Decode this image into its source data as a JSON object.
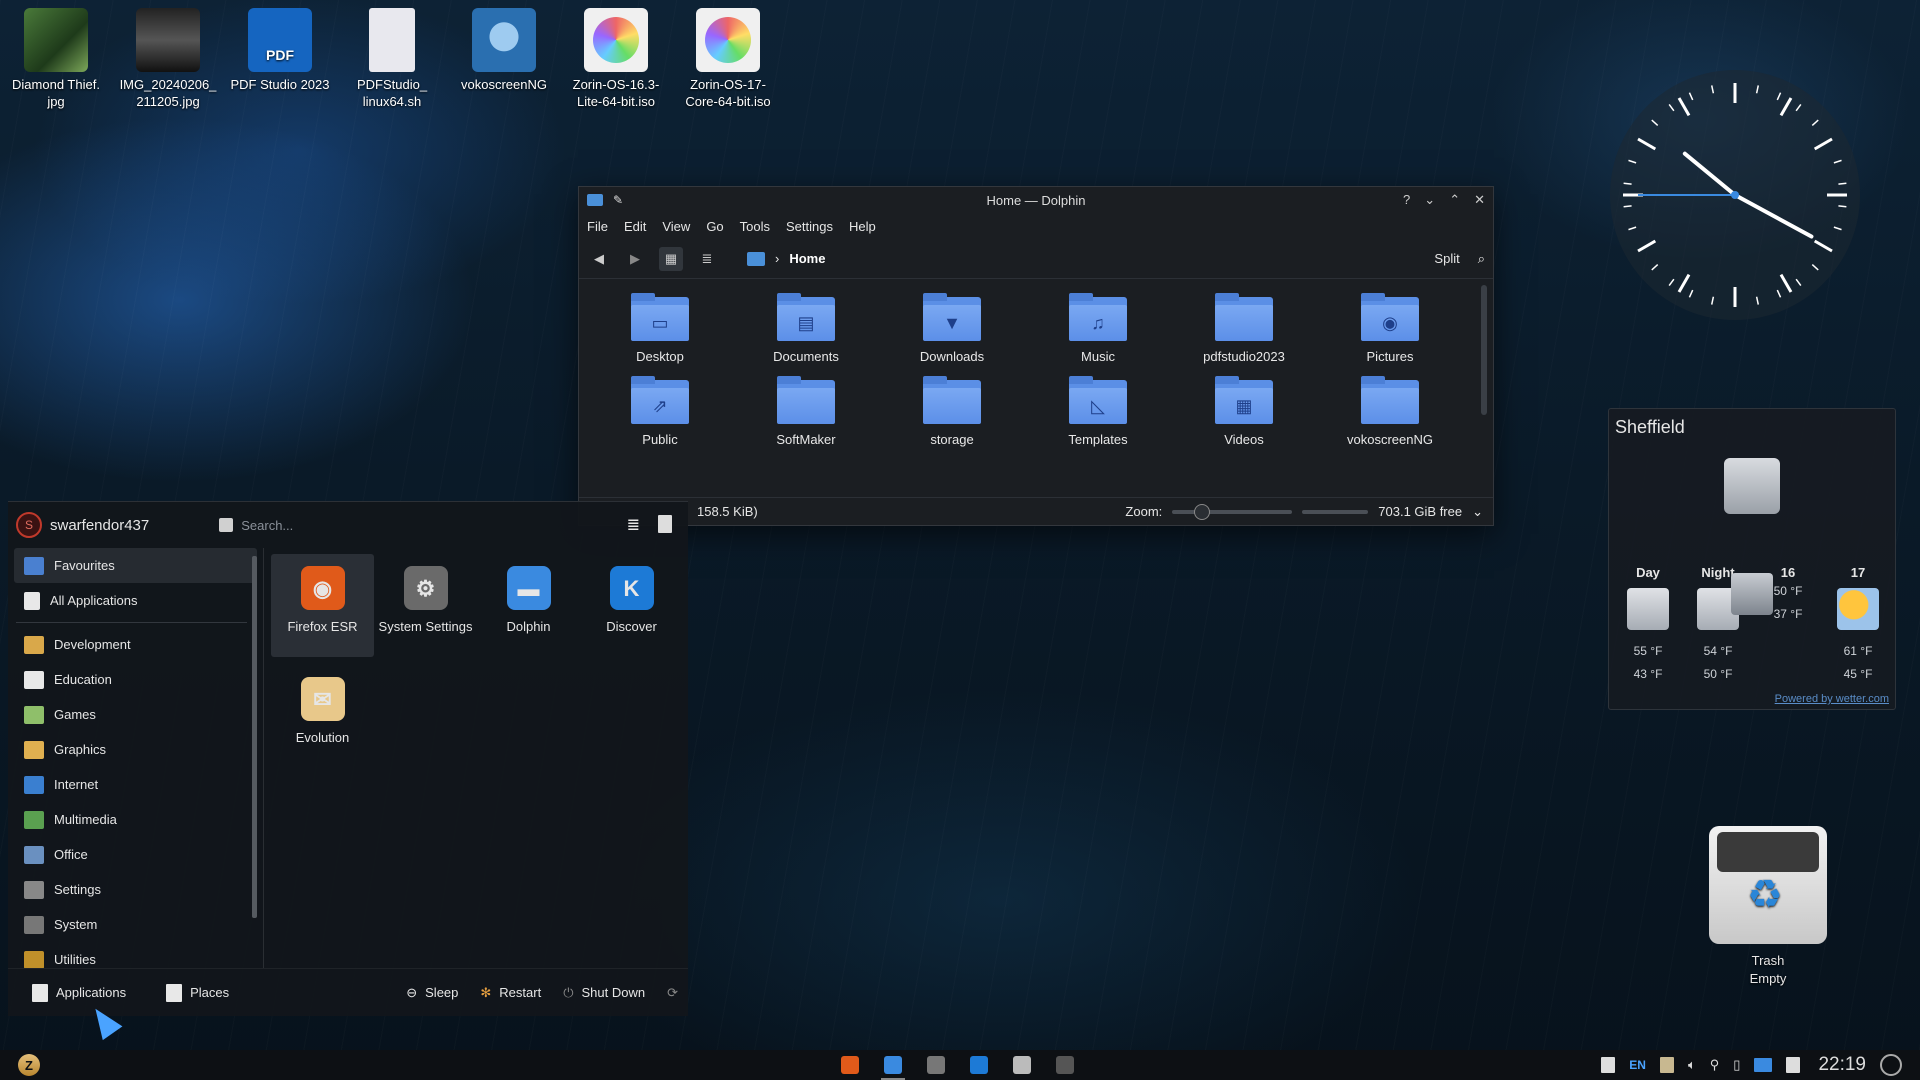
{
  "desktop": {
    "icons": [
      {
        "label": "Diamond Thief.\njpg",
        "line1": "Diamond Thief.",
        "line2": "jpg",
        "icon": "image-file-icon"
      },
      {
        "label": "IMG_20240206_211205.jpg",
        "line1": "IMG_20240206_",
        "line2": "211205.jpg",
        "icon": "image-file-icon"
      },
      {
        "label": "PDF Studio 2023",
        "line1": "PDF Studio 2023",
        "line2": "",
        "icon": "pdf-studio-icon"
      },
      {
        "label": "PDFStudio_linux64.sh",
        "line1": "PDFStudio_",
        "line2": "linux64.sh",
        "icon": "script-file-icon"
      },
      {
        "label": "vokoscreenNG",
        "line1": "vokoscreenNG",
        "line2": "",
        "icon": "vokoscreen-icon"
      },
      {
        "label": "Zorin-OS-16.3-Lite-64-bit.iso",
        "line1": "Zorin-OS-16.3-",
        "line2": "Lite-64-bit.iso",
        "icon": "disc-image-icon"
      },
      {
        "label": "Zorin-OS-17-Core-64-bit.iso",
        "line1": "Zorin-OS-17-",
        "line2": "Core-64-bit.iso",
        "icon": "disc-image-icon"
      }
    ],
    "pdf_icon_text": "PDF"
  },
  "dolphin": {
    "title": "Home — Dolphin",
    "title_controls": [
      "?",
      "⌄",
      "⌃",
      "✕"
    ],
    "menu": [
      "File",
      "Edit",
      "View",
      "Go",
      "Tools",
      "Settings",
      "Help"
    ],
    "breadcrumb": "Home",
    "split_label": "Split",
    "files": [
      {
        "name": "Desktop",
        "glyph": "▭"
      },
      {
        "name": "Documents",
        "glyph": "▤"
      },
      {
        "name": "Downloads",
        "glyph": "▼"
      },
      {
        "name": "Music",
        "glyph": "♫"
      },
      {
        "name": "pdfstudio2023",
        "glyph": ""
      },
      {
        "name": "Pictures",
        "glyph": "◉"
      },
      {
        "name": "Public",
        "glyph": "⇗"
      },
      {
        "name": "SoftMaker",
        "glyph": ""
      },
      {
        "name": "storage",
        "glyph": ""
      },
      {
        "name": "Templates",
        "glyph": "◺"
      },
      {
        "name": "Videos",
        "glyph": "▦"
      },
      {
        "name": "vokoscreenNG",
        "glyph": ""
      }
    ],
    "status_text": "158.5 KiB)",
    "zoom_label": "Zoom:",
    "free_space": "703.1 GiB free",
    "zoom_level": 0.2
  },
  "launcher": {
    "username": "swarfendor437",
    "avatar_letter": "S",
    "search_placeholder": "Search...",
    "categories_top": [
      "Favourites",
      "All Applications"
    ],
    "categories": [
      {
        "name": "Development",
        "color": "#d9a84a"
      },
      {
        "name": "Education",
        "color": "#e8e8e8"
      },
      {
        "name": "Games",
        "color": "#8fbf6a"
      },
      {
        "name": "Graphics",
        "color": "#e0b050"
      },
      {
        "name": "Internet",
        "color": "#3a7fd0"
      },
      {
        "name": "Multimedia",
        "color": "#5aa050"
      },
      {
        "name": "Office",
        "color": "#6a90c0"
      },
      {
        "name": "Settings",
        "color": "#888888"
      },
      {
        "name": "System",
        "color": "#777777"
      },
      {
        "name": "Utilities",
        "color": "#c0902a"
      }
    ],
    "apps": [
      {
        "name": "Firefox ESR",
        "bg": "#e05a1a",
        "glyph": "◉"
      },
      {
        "name": "System Settings",
        "bg": "#6a6a6a",
        "glyph": "⚙"
      },
      {
        "name": "Dolphin",
        "bg": "#3a8ae0",
        "glyph": "▬"
      },
      {
        "name": "Discover",
        "bg": "#1d7ad6",
        "glyph": "K"
      },
      {
        "name": "Evolution",
        "bg": "#e8c88a",
        "glyph": "✉"
      }
    ],
    "footer": {
      "applications": "Applications",
      "places": "Places",
      "sleep": "Sleep",
      "restart": "Restart",
      "shutdown": "Shut Down"
    }
  },
  "weather": {
    "city": "Sheffield",
    "days": [
      {
        "label": "Day",
        "high": "55 °F",
        "low": "43 °F",
        "icon": "cloudy"
      },
      {
        "label": "Night",
        "high": "54 °F",
        "low": "50 °F",
        "icon": "cloudy"
      },
      {
        "label": "16",
        "high": "50 °F",
        "low": "37 °F",
        "icon": "rain"
      },
      {
        "label": "17",
        "high": "61 °F",
        "low": "45 °F",
        "icon": "sun"
      }
    ],
    "credit": "Powered by wetter.com"
  },
  "trash": {
    "label": "Trash",
    "status": "Empty"
  },
  "taskbar": {
    "tasks": [
      {
        "name": "firefox",
        "color": "#e05a1a",
        "active": false
      },
      {
        "name": "dolphin",
        "color": "#3a8ae0",
        "active": true
      },
      {
        "name": "system-settings",
        "color": "#777777",
        "active": false
      },
      {
        "name": "discover",
        "color": "#1d7ad6",
        "active": false
      },
      {
        "name": "pdf-studio",
        "color": "#bbbbbb",
        "active": false
      },
      {
        "name": "vokoscreen",
        "color": "#555555",
        "active": false
      }
    ],
    "language": "EN",
    "time": "22:19"
  },
  "clock": {
    "hour": 10,
    "minute": 19,
    "second": 45
  }
}
